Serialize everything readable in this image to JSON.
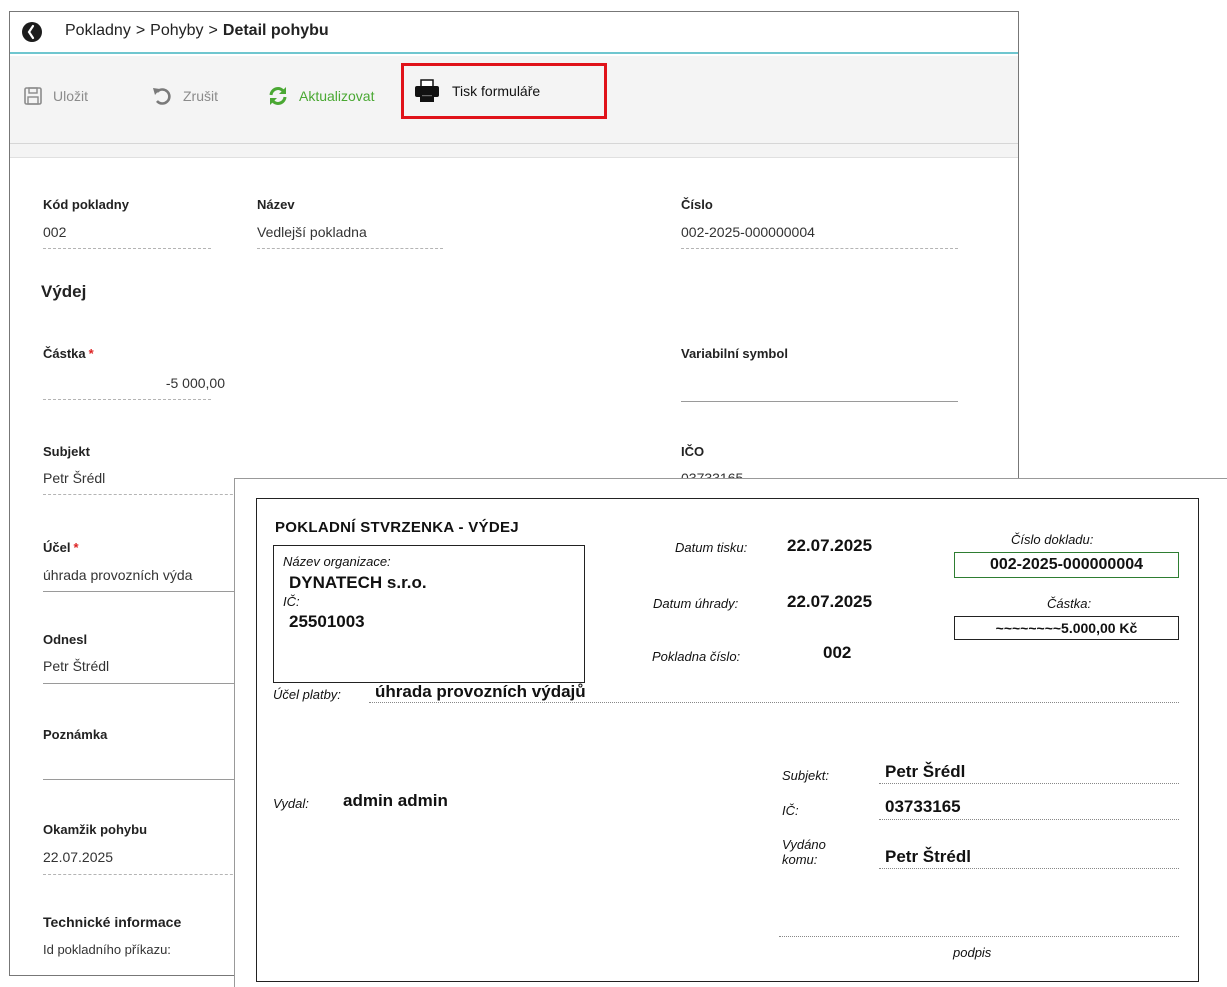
{
  "breadcrumb": {
    "part1": "Pokladny",
    "part2": "Pohyby",
    "current": "Detail pohybu",
    "separator": ">"
  },
  "toolbar": {
    "save_label": "Uložit",
    "cancel_label": "Zrušit",
    "refresh_label": "Aktualizovat",
    "print_label": "Tisk formuláře"
  },
  "colors": {
    "accent_line": "#6fc6cf",
    "refresh_green": "#4aa833",
    "highlight_red": "#e0131a",
    "required_red": "#d22222",
    "doc_number_border": "#2e7d32"
  },
  "icons": [
    "app-logo-icon",
    "floppy-disk-icon",
    "undo-icon",
    "refresh-icon",
    "printer-icon"
  ],
  "form": {
    "kod_pokladny": {
      "label": "Kód pokladny",
      "value": "002"
    },
    "nazev": {
      "label": "Název",
      "value": "Vedlejší pokladna"
    },
    "cislo": {
      "label": "Číslo",
      "value": "002-2025-000000004"
    },
    "section_title": "Výdej",
    "castka": {
      "label": "Částka",
      "required": "*",
      "value": "-5 000,00"
    },
    "variabilni_symbol": {
      "label": "Variabilní symbol",
      "value": ""
    },
    "subjekt": {
      "label": "Subjekt",
      "value": "Petr Šrédl"
    },
    "ico": {
      "label": "IČO",
      "value": "03733165"
    },
    "ucel": {
      "label": "Účel",
      "required": "*",
      "value": "úhrada provozních výda"
    },
    "odnesl": {
      "label": "Odnesl",
      "value": "Petr Štrédl"
    },
    "poznamka": {
      "label": "Poznámka",
      "value": ""
    },
    "okamzik": {
      "label": "Okamžik pohybu",
      "value": "22.07.2025"
    },
    "technicke": {
      "title": "Technické informace",
      "id_label": "Id pokladního příkazu:"
    }
  },
  "receipt": {
    "heading": "POKLADNÍ STVRZENKA - VÝDEJ",
    "org_label": "Název organizace:",
    "org_name": "DYNATECH s.r.o.",
    "ic_label": "IČ:",
    "ic_value": "25501003",
    "datum_tisku_label": "Datum tisku:",
    "datum_tisku": "22.07.2025",
    "datum_uhrady_label": "Datum úhrady:",
    "datum_uhrady": "22.07.2025",
    "pokladna_label": "Pokladna číslo:",
    "pokladna_value": "002",
    "cislo_dokladu_label": "Číslo dokladu:",
    "cislo_dokladu": "002-2025-000000004",
    "castka_label": "Částka:",
    "castka_value": "~~~~~~~~5.000,00 Kč",
    "ucel_label": "Účel platby:",
    "ucel_value": "úhrada provozních výdajů",
    "vydal_label": "Vydal:",
    "vydal_value": "admin admin",
    "subjekt_label": "Subjekt:",
    "subjekt_value": "Petr Šrédl",
    "ic2_label": "IČ:",
    "ic2_value": "03733165",
    "vydano_label_line1": "Vydáno",
    "vydano_label_line2": "komu:",
    "vydano_value": "Petr Štrédl",
    "podpis_label": "podpis"
  }
}
